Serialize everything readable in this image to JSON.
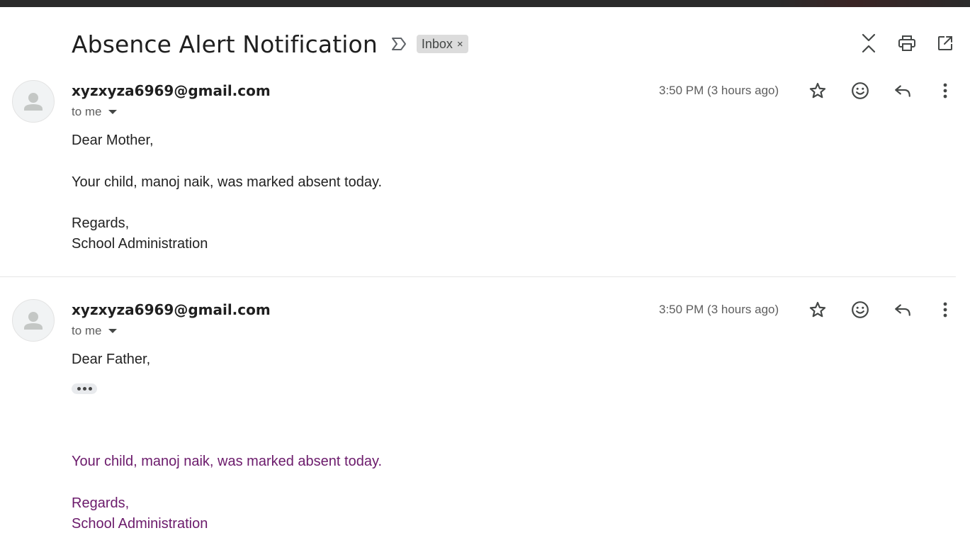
{
  "subject": {
    "title": "Absence Alert Notification",
    "label": "Inbox",
    "label_close": "×"
  },
  "top_actions": [
    "collapse-all-icon",
    "print-icon",
    "open-in-new-window-icon"
  ],
  "messages": [
    {
      "sender": "xyzxyza6969@gmail.com",
      "to": "to me",
      "time": "3:50 PM (3 hours ago)",
      "body": {
        "greeting": "Dear Mother,",
        "line1": "Your child, manoj naik, was marked absent today.",
        "closing": "Regards,",
        "signature": "School Administration"
      }
    },
    {
      "sender": "xyzxyza6969@gmail.com",
      "to": "to me",
      "time": "3:50 PM (3 hours ago)",
      "body": {
        "greeting": "Dear Father,",
        "line1": "Your child, manoj naik, was marked absent today.",
        "closing": "Regards,",
        "signature": "School Administration"
      }
    }
  ],
  "colors": {
    "quoted_text": "#6b1a6b",
    "chip_bg": "#dcdcdc",
    "icon": "#444746"
  }
}
